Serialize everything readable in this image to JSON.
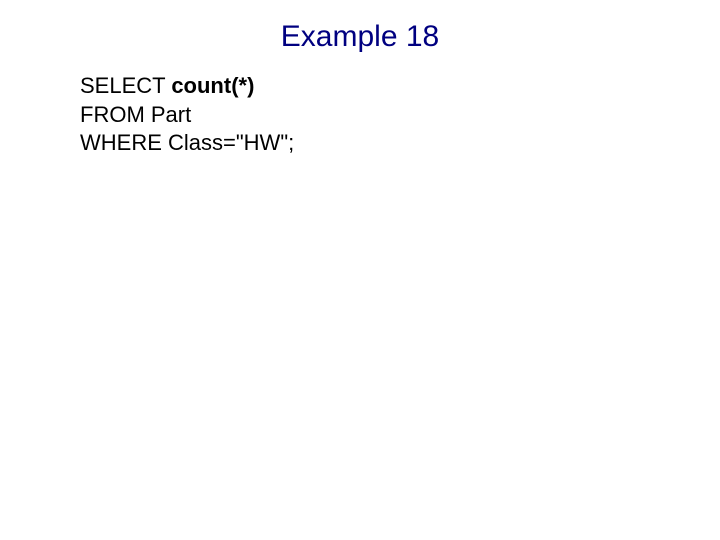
{
  "title": "Example 18",
  "code": {
    "line1_keyword": "SELECT ",
    "line1_bold": "count(*)",
    "line2": "FROM Part",
    "line3": "WHERE Class=\"HW\";"
  }
}
